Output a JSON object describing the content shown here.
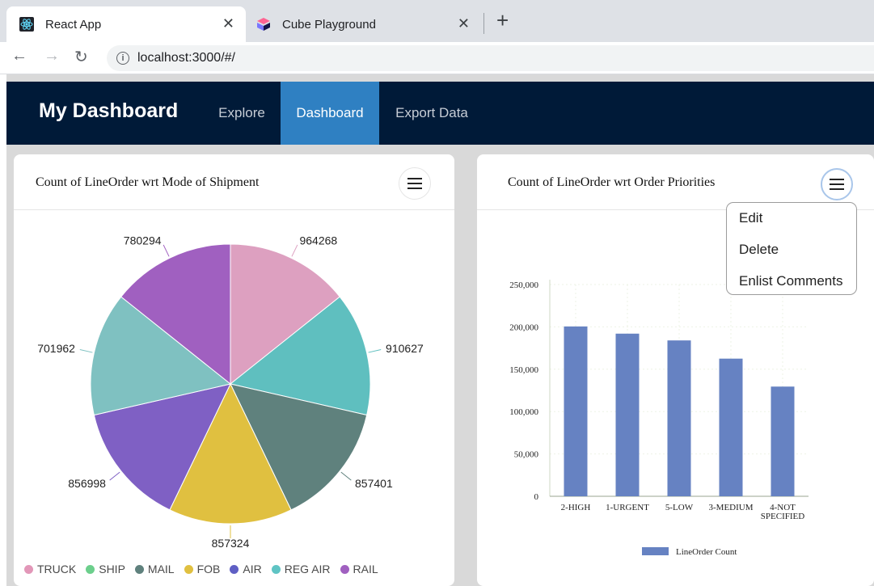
{
  "browser": {
    "tabs": [
      {
        "title": "React App",
        "icon": "react-icon"
      },
      {
        "title": "Cube Playground",
        "icon": "cube-icon"
      }
    ],
    "url": "localhost:3000/#/"
  },
  "app": {
    "brand": "My Dashboard",
    "menu": [
      "Explore",
      "Dashboard",
      "Export Data"
    ],
    "active_menu": "Dashboard",
    "colors": {
      "header": "#001a38",
      "active": "#2f80c2",
      "background": "#d9d9d9"
    }
  },
  "cards": {
    "left": {
      "title": "Count of LineOrder wrt Mode of Shipment"
    },
    "right": {
      "title": "Count of LineOrder wrt Order Priorities"
    }
  },
  "dropdown": {
    "items": [
      "Edit",
      "Delete",
      "Enlist Comments"
    ]
  },
  "chart_data": [
    {
      "type": "pie",
      "title": "Count of LineOrder wrt Mode of Shipment",
      "categories": [
        "TRUCK",
        "SHIP",
        "MAIL",
        "FOB",
        "AIR",
        "REG AIR",
        "RAIL"
      ],
      "values": [
        964268,
        910627,
        857401,
        857324,
        856998,
        701962,
        780294
      ],
      "colors": [
        "#dda0c0",
        "#5fbfbf",
        "#5f817d",
        "#e0c040",
        "#7f60c4",
        "#7fc1c1",
        "#a060c0"
      ],
      "legend": {
        "labels": [
          "TRUCK",
          "SHIP",
          "MAIL",
          "FOB",
          "AIR",
          "REG AIR",
          "RAIL"
        ],
        "colors": [
          "#e297b8",
          "#6ccf8c",
          "#5f817d",
          "#e0c040",
          "#5f5fc4",
          "#5fc4c4",
          "#a060c0"
        ],
        "placement": "bottom"
      }
    },
    {
      "type": "bar",
      "title": "Count of LineOrder wrt Order Priorities",
      "categories": [
        "2-HIGH",
        "1-URGENT",
        "5-LOW",
        "3-MEDIUM",
        "4-NOT SPECIFIED"
      ],
      "category_lines": [
        [
          "2-HIGH"
        ],
        [
          "1-URGENT"
        ],
        [
          "5-LOW"
        ],
        [
          "3-MEDIUM"
        ],
        [
          "4-NOT",
          "SPECIFIED"
        ]
      ],
      "series": [
        {
          "name": "LineOrder Count",
          "values": [
            200500,
            192000,
            184000,
            162500,
            129500
          ],
          "color": "#6682c2"
        }
      ],
      "ylim": [
        0,
        250000
      ],
      "yticks": [
        0,
        50000,
        100000,
        150000,
        200000,
        250000
      ],
      "ytick_labels": [
        "0",
        "50,000",
        "100,000",
        "150,000",
        "200,000",
        "250,000"
      ],
      "legend_placement": "bottom",
      "grid": true
    }
  ]
}
